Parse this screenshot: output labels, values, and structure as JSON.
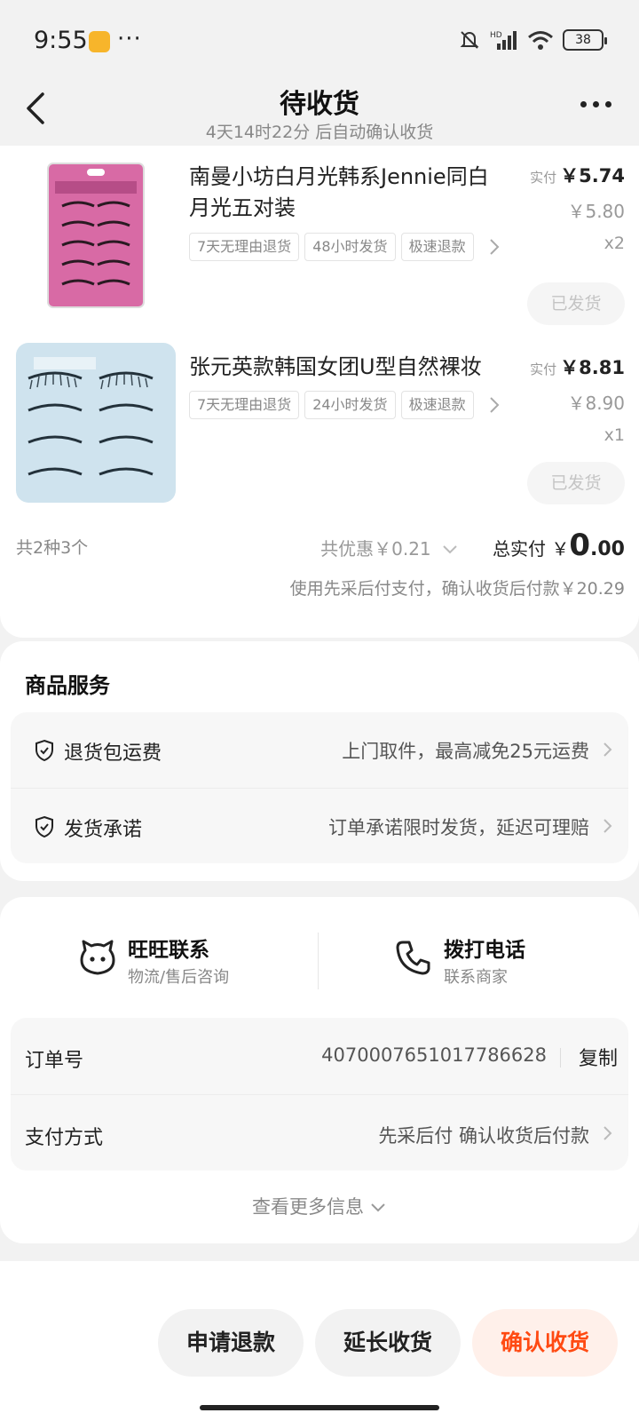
{
  "status_bar": {
    "time": "9:55",
    "dots": "···",
    "battery": "38"
  },
  "header": {
    "title": "待收货",
    "subtitle": "4天14时22分 后自动确认收货"
  },
  "products": [
    {
      "name": "南曼小坊白月光韩系Jennie同白月光五对装",
      "tags": [
        "7天无理由退货",
        "48小时发货",
        "极速退款"
      ],
      "real_price_label": "实付",
      "real_price": "￥5.74",
      "original_price": "￥5.80",
      "quantity": "x2",
      "status_button": "已发货",
      "image_color": "#d86aa5"
    },
    {
      "name": "张元英款韩国女团U型自然裸妆",
      "tags": [
        "7天无理由退货",
        "24小时发货",
        "极速退款"
      ],
      "real_price_label": "实付",
      "real_price": "￥8.81",
      "original_price": "￥8.90",
      "quantity": "x1",
      "status_button": "已发货",
      "image_color": "#cfe3ee"
    }
  ],
  "summary": {
    "count": "共2种3个",
    "discount": "共优惠￥0.21",
    "total_label": "总实付",
    "total_currency": "￥",
    "total_int": "0",
    "total_dec": ".00",
    "pay_note": "使用先采后付支付，确认收货后付款￥20.29"
  },
  "services": {
    "title": "商品服务",
    "items": [
      {
        "label": "退货包运费",
        "value": "上门取件，最高减免25元运费",
        "icon": "shield-check-icon"
      },
      {
        "label": "发货承诺",
        "value": "订单承诺限时发货，延迟可理赔",
        "icon": "shield-check-icon"
      }
    ]
  },
  "contact": {
    "wangwang": {
      "title": "旺旺联系",
      "subtitle": "物流/售后咨询",
      "icon": "wangwang-icon"
    },
    "call": {
      "title": "拨打电话",
      "subtitle": "联系商家",
      "icon": "phone-icon"
    }
  },
  "order_info": {
    "order_no_label": "订单号",
    "order_no": "4070007651017786628",
    "copy": "复制",
    "pay_method_label": "支付方式",
    "pay_method": "先采后付 确认收货后付款",
    "more_info": "查看更多信息"
  },
  "actions": {
    "refund": "申请退款",
    "extend": "延长收货",
    "confirm": "确认收货"
  },
  "colors": {
    "accent": "#ff4a12",
    "accent_bg": "#fff0ea"
  }
}
